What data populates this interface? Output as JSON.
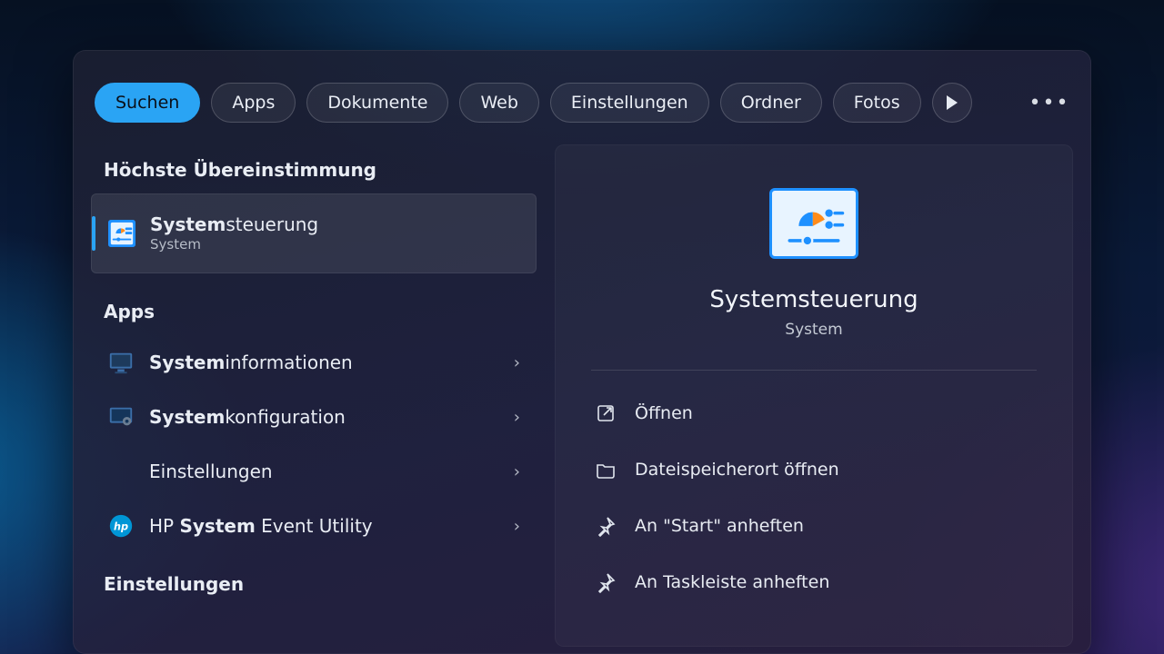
{
  "tabs": {
    "items": [
      "Suchen",
      "Apps",
      "Dokumente",
      "Web",
      "Einstellungen",
      "Ordner",
      "Fotos"
    ],
    "active_index": 0
  },
  "left": {
    "best_match_label": "Höchste Übereinstimmung",
    "top_result": {
      "title_bold": "System",
      "title_rest": "steuerung",
      "subtitle": "System"
    },
    "apps_label": "Apps",
    "apps": [
      {
        "title_bold": "System",
        "title_rest": "informationen",
        "subtitle": ""
      },
      {
        "title_bold": "System",
        "title_rest": "konfiguration",
        "subtitle": ""
      },
      {
        "title_bold": "",
        "title_rest": "Einstellungen",
        "subtitle": ""
      },
      {
        "title_bold": "",
        "title_rest_prefix": "HP ",
        "title_bold2": "System",
        "title_rest": " Event Utility",
        "subtitle": ""
      }
    ],
    "settings_label": "Einstellungen"
  },
  "right": {
    "title": "Systemsteuerung",
    "category": "System",
    "actions": [
      "Öffnen",
      "Dateispeicherort öffnen",
      "An \"Start\" anheften",
      "An Taskleiste anheften"
    ]
  }
}
